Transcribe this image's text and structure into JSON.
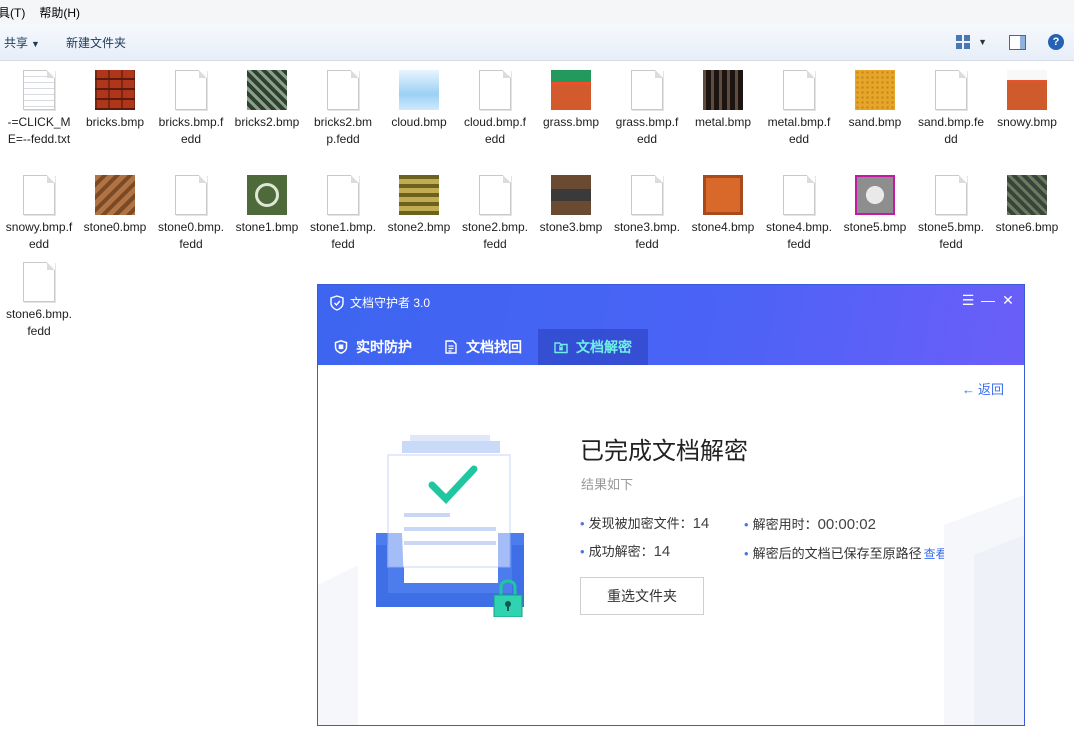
{
  "menu": {
    "tools": "具(T)",
    "help": "帮助(H)"
  },
  "toolbar": {
    "share": "共享",
    "new_folder": "新建文件夹"
  },
  "files": [
    {
      "name": "-=CLICK_ME=--fedd.txt",
      "kind": "txt"
    },
    {
      "name": "bricks.bmp",
      "kind": "bricks"
    },
    {
      "name": "bricks.bmp.fedd",
      "kind": "doc"
    },
    {
      "name": "bricks2.bmp",
      "kind": "bricks2"
    },
    {
      "name": "bricks2.bmp.fedd",
      "kind": "doc"
    },
    {
      "name": "cloud.bmp",
      "kind": "cloud"
    },
    {
      "name": "cloud.bmp.fedd",
      "kind": "doc"
    },
    {
      "name": "grass.bmp",
      "kind": "grass"
    },
    {
      "name": "grass.bmp.fedd",
      "kind": "doc"
    },
    {
      "name": "metal.bmp",
      "kind": "metal"
    },
    {
      "name": "metal.bmp.fedd",
      "kind": "doc"
    },
    {
      "name": "sand.bmp",
      "kind": "sand"
    },
    {
      "name": "sand.bmp.fedd",
      "kind": "doc"
    },
    {
      "name": "snowy.bmp",
      "kind": "snowy"
    },
    {
      "name": "snowy.bmp.fedd",
      "kind": "doc"
    },
    {
      "name": "stone0.bmp",
      "kind": "stone0"
    },
    {
      "name": "stone0.bmp.fedd",
      "kind": "doc"
    },
    {
      "name": "stone1.bmp",
      "kind": "stone1"
    },
    {
      "name": "stone1.bmp.fedd",
      "kind": "doc"
    },
    {
      "name": "stone2.bmp",
      "kind": "stone2"
    },
    {
      "name": "stone2.bmp.fedd",
      "kind": "doc"
    },
    {
      "name": "stone3.bmp",
      "kind": "stone3"
    },
    {
      "name": "stone3.bmp.fedd",
      "kind": "doc"
    },
    {
      "name": "stone4.bmp",
      "kind": "stone4"
    },
    {
      "name": "stone4.bmp.fedd",
      "kind": "doc"
    },
    {
      "name": "stone5.bmp",
      "kind": "stone5"
    },
    {
      "name": "stone5.bmp.fedd",
      "kind": "doc"
    },
    {
      "name": "stone6.bmp",
      "kind": "stone6"
    },
    {
      "name": "stone6.bmp.fedd",
      "kind": "doc"
    }
  ],
  "app": {
    "title": "文档守护者 3.0",
    "tabs": [
      {
        "label": "实时防护",
        "icon": "shield-icon"
      },
      {
        "label": "文档找回",
        "icon": "doc-restore-icon"
      },
      {
        "label": "文档解密",
        "icon": "folder-lock-icon"
      }
    ],
    "active_tab": 2,
    "back": "返回",
    "result_title": "已完成文档解密",
    "result_sub": "结果如下",
    "found_label": "发现被加密文件：",
    "found_value": "14",
    "time_label": "解密用时：",
    "time_value": "00:00:02",
    "success_label": "成功解密：",
    "success_value": "14",
    "saved_text": "解密后的文档已保存至原路径",
    "view_link": "查看",
    "rechoose": "重选文件夹",
    "colors": {
      "header": "#4a63f6",
      "accent": "#3a6ef0",
      "check": "#1fc7a0"
    }
  }
}
